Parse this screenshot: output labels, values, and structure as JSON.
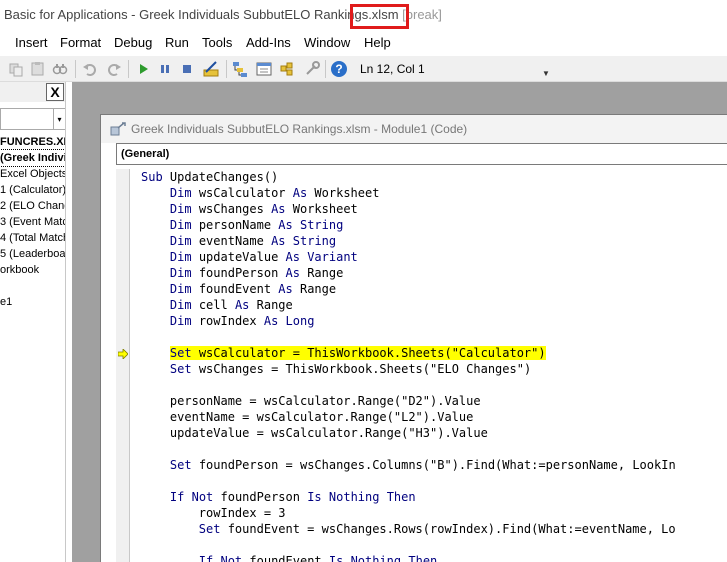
{
  "window": {
    "title": "Basic for Applications - Greek Individuals SubbutELO Rankings.xlsm",
    "mode": "[break]",
    "highlight_color": "#e01b1b"
  },
  "menu": [
    "Insert",
    "Format",
    "Debug",
    "Run",
    "Tools",
    "Add-Ins",
    "Window",
    "Help"
  ],
  "toolbar": {
    "icons": [
      "copy-icon",
      "paste-icon",
      "find-icon",
      "undo-icon",
      "redo-icon",
      "run-icon",
      "break-icon",
      "reset-icon",
      "design-mode-icon",
      "project-explorer-icon",
      "properties-icon",
      "object-browser-icon",
      "toolbox-icon",
      "help-icon"
    ],
    "position": "Ln 12, Col 1"
  },
  "project_panel": {
    "close_label": "X",
    "items": [
      {
        "label": "FUNCRES.XL",
        "bold": true
      },
      {
        "label": "(Greek Indivi",
        "bold": true
      },
      {
        "label": "Excel Objects",
        "bold": false
      },
      {
        "label": "1 (Calculator)",
        "bold": false
      },
      {
        "label": "2 (ELO Change",
        "bold": false
      },
      {
        "label": "3 (Event Matc",
        "bold": false
      },
      {
        "label": "4 (Total Match",
        "bold": false
      },
      {
        "label": "5 (Leaderboar",
        "bold": false
      },
      {
        "label": "orkbook",
        "bold": false
      },
      {
        "label": "",
        "bold": false
      },
      {
        "label": "e1",
        "bold": false
      }
    ]
  },
  "code_window": {
    "title": "Greek Individuals SubbutELO Rankings.xlsm - Module1 (Code)",
    "object_combo": "(General)",
    "current_line_index": 11,
    "lines": [
      "Sub UpdateChanges()",
      "    Dim wsCalculator As Worksheet",
      "    Dim wsChanges As Worksheet",
      "    Dim personName As String",
      "    Dim eventName As String",
      "    Dim updateValue As Variant",
      "    Dim foundPerson As Range",
      "    Dim foundEvent As Range",
      "    Dim cell As Range",
      "    Dim rowIndex As Long",
      "",
      "    Set wsCalculator = ThisWorkbook.Sheets(\"Calculator\")",
      "    Set wsChanges = ThisWorkbook.Sheets(\"ELO Changes\")",
      "",
      "    personName = wsCalculator.Range(\"D2\").Value",
      "    eventName = wsCalculator.Range(\"L2\").Value",
      "    updateValue = wsCalculator.Range(\"H3\").Value",
      "",
      "    Set foundPerson = wsChanges.Columns(\"B\").Find(What:=personName, LookIn",
      "",
      "    If Not foundPerson Is Nothing Then",
      "        rowIndex = 3",
      "        Set foundEvent = wsChanges.Rows(rowIndex).Find(What:=eventName, Lo",
      "",
      "        If Not foundEvent Is Nothing Then"
    ]
  }
}
